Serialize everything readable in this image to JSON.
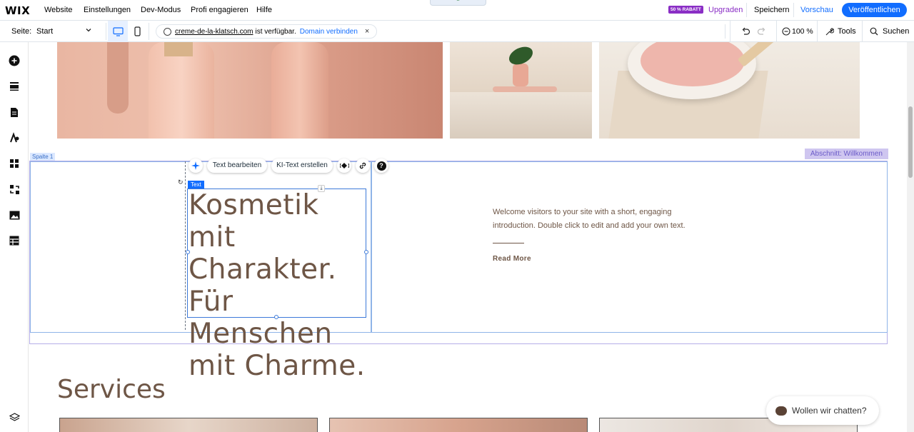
{
  "topbar": {
    "logo": "WIX",
    "menu": [
      "Website",
      "Einstellungen",
      "Dev-Modus",
      "Profi engagieren",
      "Hilfe"
    ],
    "discount_badge": "50 % RABATT",
    "upgrade": "Upgraden",
    "save": "Speichern",
    "preview": "Vorschau",
    "publish": "Veröffentlichen",
    "collapse_tab": "⌃"
  },
  "toolbar": {
    "page_label": "Seite:",
    "page_value": "Start",
    "domain": "creme-de-la-klatsch.com",
    "domain_available": "ist verfügbar.",
    "domain_connect": "Domain verbinden",
    "domain_close": "×",
    "zoom": "100 %",
    "tools": "Tools",
    "search": "Suchen"
  },
  "leftbar": {
    "icons": [
      "add-icon",
      "sections-icon",
      "pages-icon",
      "design-icon",
      "apps-icon",
      "business-icon",
      "media-icon",
      "cms-icon",
      "layers-icon"
    ]
  },
  "canvas": {
    "column_label": "Spalte 1",
    "section_label": "Abschnitt: Willkommen",
    "text_badge": "Text",
    "context_menu": {
      "edit_text": "Text bearbeiten",
      "ai_text": "KI-Text erstellen",
      "help": "?"
    },
    "heading": "Kosmetik mit Charakter. Für Menschen mit Charme.",
    "welcome_text": "Welcome visitors to your site with a short, engaging introduction. Double click to edit and add your own text.",
    "read_more": "Read More",
    "services_title": "Services",
    "chat": "Wollen wir chatten?"
  },
  "colors": {
    "accent": "#116dff",
    "brand_text": "#6e5646",
    "upgrade": "#8a2ec5"
  }
}
